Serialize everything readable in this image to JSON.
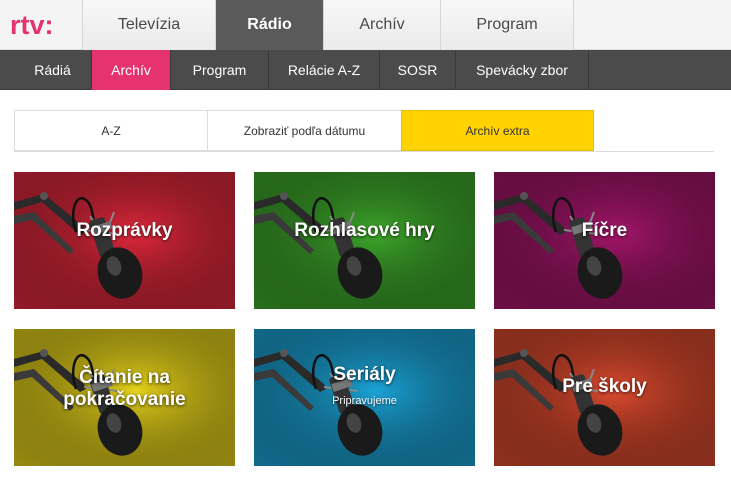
{
  "header": {
    "logo_text": "rtv:",
    "brand_color": "#e5336f",
    "tabs": [
      {
        "label": "Televízia",
        "active": false
      },
      {
        "label": "Rádio",
        "active": true
      },
      {
        "label": "Archív",
        "active": false
      },
      {
        "label": "Program",
        "active": false
      }
    ]
  },
  "subnav": {
    "items": [
      {
        "label": "Rádiá",
        "active": false
      },
      {
        "label": "Archív",
        "active": true
      },
      {
        "label": "Program",
        "active": false
      },
      {
        "label": "Relácie A-Z",
        "active": false
      },
      {
        "label": "SOSR",
        "active": false
      },
      {
        "label": "Spevácky zbor",
        "active": false
      }
    ],
    "active_color": "#e5336f"
  },
  "filter": {
    "tabs": [
      {
        "label": "A-Z",
        "active": false
      },
      {
        "label": "Zobraziť podľa dátumu",
        "active": false
      },
      {
        "label": "Archív extra",
        "active": true
      }
    ],
    "active_color": "#ffd200"
  },
  "tiles": [
    {
      "title": "Rozprávky",
      "subtitle": "",
      "color": "#e0283c",
      "icon": "microphone-icon"
    },
    {
      "title": "Rozhlasové hry",
      "subtitle": "",
      "color": "#3ea82b",
      "icon": "microphone-icon"
    },
    {
      "title": "Fíčre",
      "subtitle": "",
      "color": "#a5166b",
      "icon": "microphone-icon"
    },
    {
      "title_line1": "Čítanie na",
      "title_line2": "pokračovanie",
      "subtitle": "",
      "color": "#e6d21a",
      "icon": "microphone-icon"
    },
    {
      "title": "Seriály",
      "subtitle": "Pripravujeme",
      "color": "#1ba3d6",
      "icon": "microphone-icon"
    },
    {
      "title": "Pre školy",
      "subtitle": "",
      "color": "#dc4a2e",
      "icon": "microphone-icon"
    }
  ]
}
